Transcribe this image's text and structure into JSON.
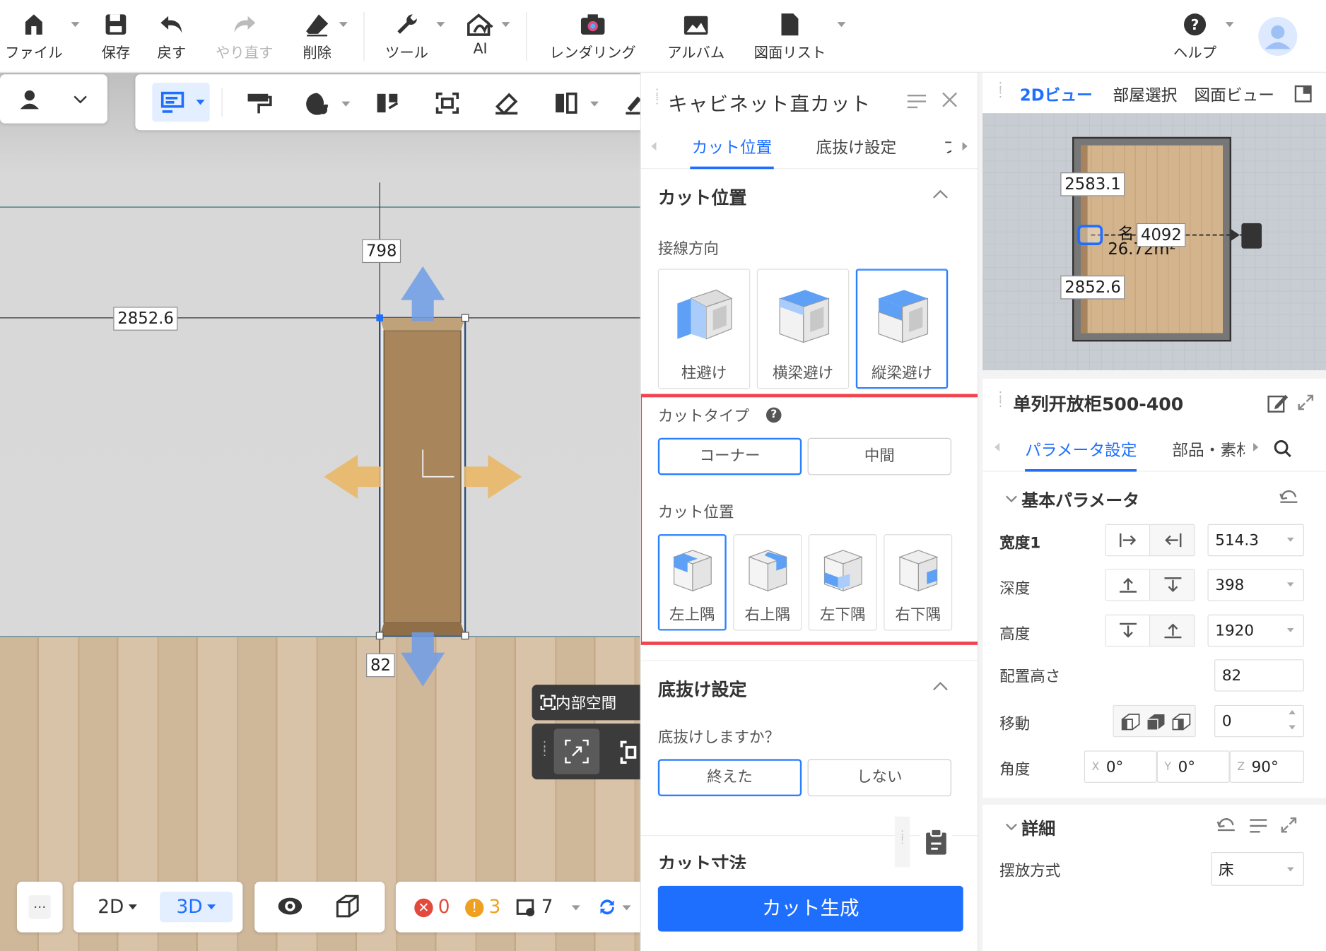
{
  "toolbar": {
    "file": "ファイル",
    "save": "保存",
    "undo": "戻す",
    "redo": "やり直す",
    "delete": "削除",
    "tools": "ツール",
    "ai": "AI",
    "rendering": "レンダリング",
    "album": "アルバム",
    "drawing_list": "図面リスト",
    "help": "ヘルプ"
  },
  "viewport": {
    "dim_top": "798",
    "dim_left": "2852.6",
    "dim_bottom": "82",
    "inner_space": "内部空間"
  },
  "bottombar": {
    "more": "...",
    "mode_2d": "2D",
    "mode_3d": "3D",
    "errors": "0",
    "warnings": "3",
    "items": "7"
  },
  "panel": {
    "title": "キャビネット直カット",
    "tabs": [
      "カット位置",
      "底抜け設定",
      "フ"
    ],
    "cut_section_title": "カット位置",
    "tangent_label": "接線方向",
    "tangent_options": [
      "柱避け",
      "横梁避け",
      "縦梁避け"
    ],
    "cut_type_label": "カットタイプ",
    "cut_type_options": [
      "コーナー",
      "中間"
    ],
    "cut_pos_label": "カット位置",
    "cut_pos_options": [
      "左上隅",
      "右上隅",
      "左下隅",
      "右下隅"
    ],
    "bottom_section_title": "底抜け設定",
    "bottom_question": "底抜けしますか？",
    "bottom_options": [
      "終えた",
      "しない"
    ],
    "cut_size_title": "カット寸法",
    "generate_button": "カット生成",
    "highlight_color": "#f0454f",
    "accent_color": "#2a7fff"
  },
  "view2d": {
    "tabs": [
      "2Dビュー",
      "部屋選択",
      "図面ビュー"
    ],
    "dim_top": "2583.1",
    "dim_center": "4092",
    "dim_bottom": "2852.6",
    "room_name": "名",
    "room_area": "26.72m²"
  },
  "props": {
    "title": "单列开放柜500-400",
    "tabs": [
      "パラメータ設定",
      "部品・素材"
    ],
    "basic_title": "基本パラメータ",
    "rows": [
      {
        "label": "宽度1",
        "value": "514.3"
      },
      {
        "label": "深度",
        "value": "398"
      },
      {
        "label": "高度",
        "value": "1920"
      },
      {
        "label": "配置高さ",
        "value": "82"
      },
      {
        "label": "移動",
        "value": "0"
      }
    ],
    "angle_label": "角度",
    "angle": {
      "x_label": "X",
      "x": "0°",
      "y_label": "Y",
      "y": "0°",
      "z_label": "Z",
      "z": "90°"
    },
    "detail_title": "詳細",
    "placement_label": "摆放方式",
    "placement_value": "床"
  }
}
